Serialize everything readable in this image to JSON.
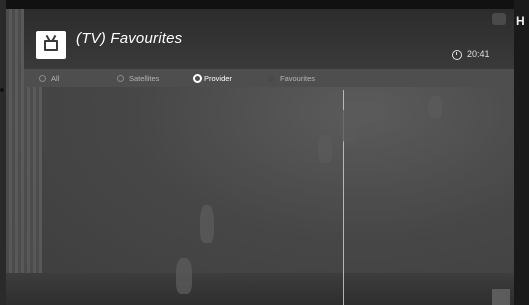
{
  "header": {
    "title": "(TV) Favourites",
    "time": "20:41",
    "icon": "tv-icon",
    "clock_icon": "clock-icon"
  },
  "tabs": [
    {
      "label": "All",
      "selected": false
    },
    {
      "label": "Satellites",
      "selected": false
    },
    {
      "label": "Provider",
      "selected": true
    },
    {
      "label": "Favourites",
      "selected": false
    }
  ],
  "edge": {
    "right_letter": "H"
  },
  "colors": {
    "overlay": "#2c2c2c",
    "tab_bar": "#4e4e4e",
    "text": "#ffffff"
  }
}
